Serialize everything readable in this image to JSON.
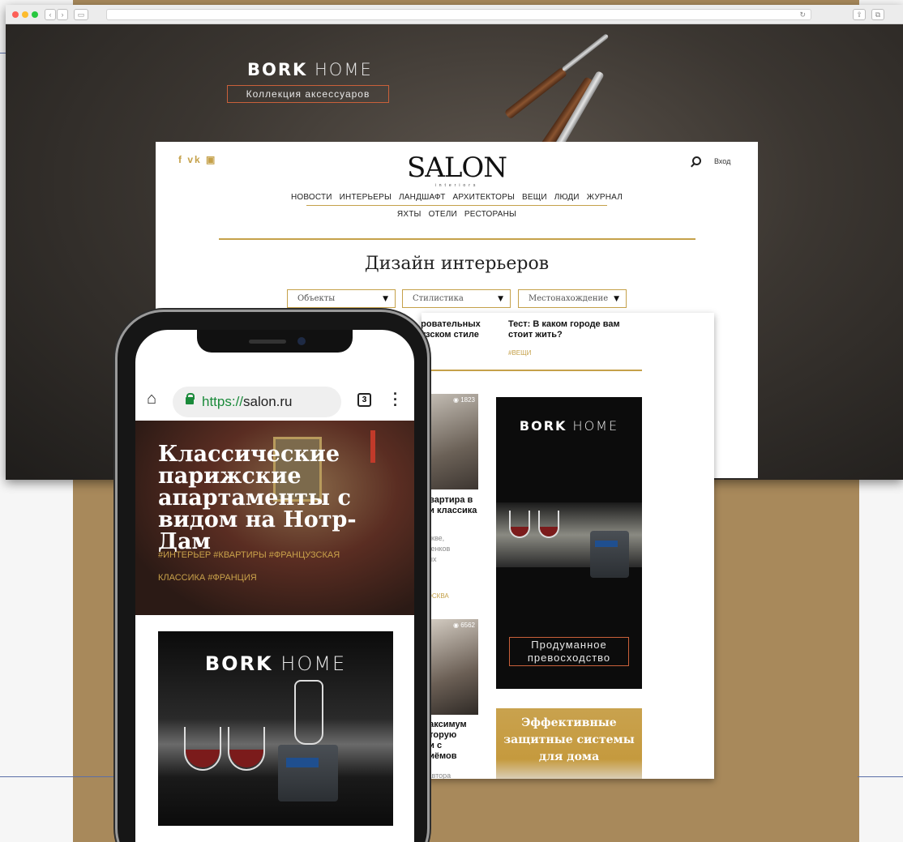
{
  "browser": {
    "url_text": ""
  },
  "banner": {
    "brand_bold": "BORK",
    "brand_light": "HOME",
    "tagline": "Коллекция аксессуаров"
  },
  "site": {
    "logo": "SALON",
    "logo_sub": "interiors",
    "social": [
      "f",
      "vk",
      "ig"
    ],
    "login": "Вход",
    "nav_row1": [
      "НОВОСТИ",
      "ИНТЕРЬЕРЫ",
      "ЛАНДШАФТ",
      "АРХИТЕКТОРЫ",
      "ВЕЩИ",
      "ЛЮДИ",
      "ЖУРНАЛ"
    ],
    "nav_row2": [
      "ЯХТЫ",
      "ОТЕЛИ",
      "РЕСТОРАНЫ"
    ],
    "page_title": "Дизайн интерьеров",
    "filters": [
      {
        "label": "Объекты"
      },
      {
        "label": "Стилистика"
      },
      {
        "label": "Местонахождение"
      }
    ]
  },
  "content": {
    "article_top_left": [
      "...ровательных",
      "...узском стиле"
    ],
    "article_top_right": {
      "title": "Тест: В каком городе вам стоит жить?",
      "tag": "#ВЕЩИ"
    },
    "card1": {
      "views": "1823",
      "title_lines": [
        "...вартира в",
        "...и классика"
      ],
      "desc_lines": [
        "...скве,",
        "...тенков",
        "...ых"
      ],
      "tag": "...ОСКВА"
    },
    "card2": {
      "views": "6562",
      "title_lines": [
        "...аксимум",
        "...торую",
        "...и с",
        "...иёмов"
      ],
      "desc_lines": [
        "...автора"
      ]
    },
    "ad_black": {
      "brand_bold": "BORK",
      "brand_light": "HOME",
      "slogan_line1": "Продуманное",
      "slogan_line2": "превосходство"
    },
    "ad_gold": {
      "line1": "Эффективные",
      "line2": "защитные системы",
      "line3": "для дома"
    }
  },
  "phone": {
    "url_scheme": "https://",
    "url_host": "salon.ru",
    "tab_count": "3",
    "hero_title": "Классические парижские апартаменты с видом на Нотр-Дам",
    "hero_tags_line1": "#ИНТЕРЬЕР #КВАРТИРЫ #ФРАНЦУЗСКАЯ",
    "hero_tags_line2": "КЛАССИКА #ФРАНЦИЯ",
    "ad": {
      "brand_bold": "BORK",
      "brand_light": "HOME"
    }
  }
}
